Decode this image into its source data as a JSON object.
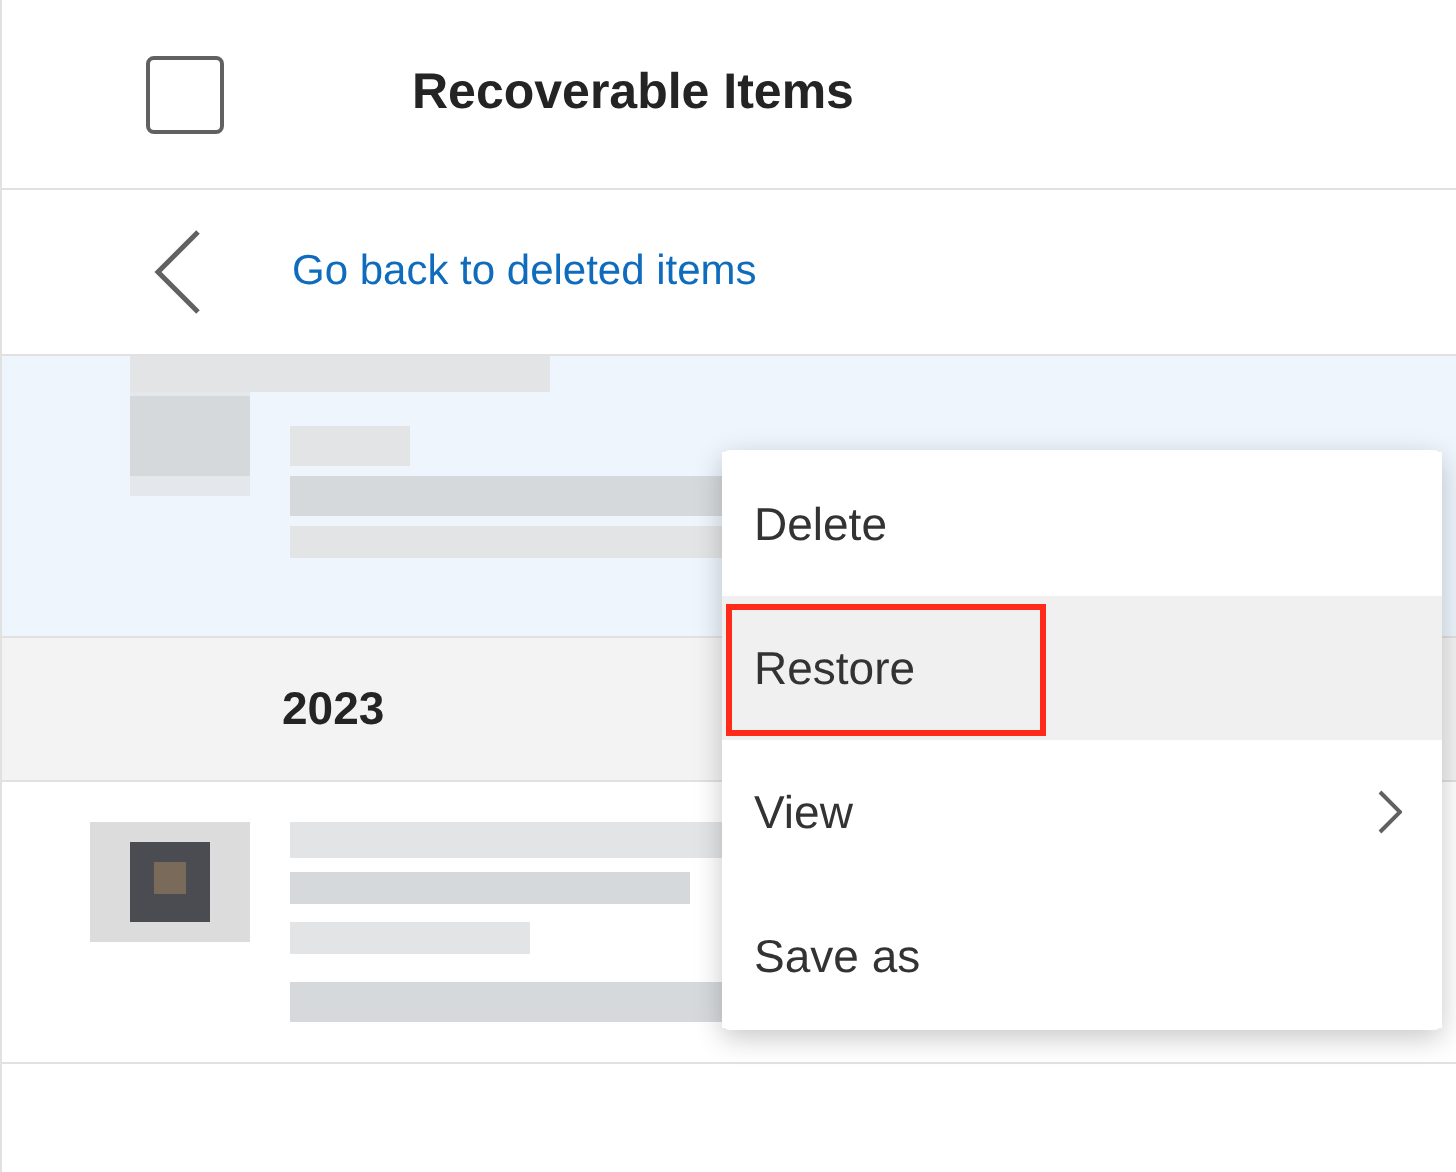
{
  "header": {
    "title": "Recoverable Items",
    "checked": false
  },
  "back_link": {
    "label": "Go back to deleted items"
  },
  "sections": [
    {
      "kind": "item",
      "selected": true
    },
    {
      "kind": "group",
      "label": "2023"
    },
    {
      "kind": "item",
      "selected": false,
      "avatar": true
    }
  ],
  "context_menu": [
    {
      "label": "Delete",
      "selected": false,
      "highlighted": false,
      "submenu": false
    },
    {
      "label": "Restore",
      "selected": true,
      "highlighted": true,
      "submenu": false
    },
    {
      "label": "View",
      "selected": false,
      "highlighted": false,
      "submenu": true
    },
    {
      "label": "Save as",
      "selected": false,
      "highlighted": false,
      "submenu": false
    }
  ]
}
